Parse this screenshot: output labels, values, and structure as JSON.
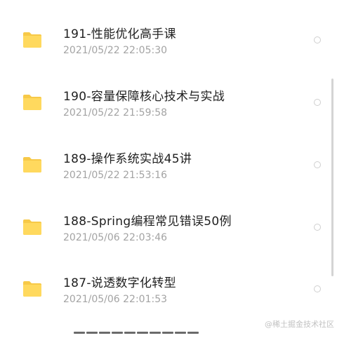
{
  "file_list": {
    "items": [
      {
        "name": "191-性能优化高手课",
        "date": "2021/05/22 22:05:30"
      },
      {
        "name": "190-容量保障核心技术与实战",
        "date": "2021/05/22 21:59:58"
      },
      {
        "name": "189-操作系统实战45讲",
        "date": "2021/05/22 21:53:16"
      },
      {
        "name": "188-Spring编程常见错误50例",
        "date": "2021/05/06 22:03:46"
      },
      {
        "name": "187-说透数字化转型",
        "date": "2021/05/06 22:01:53"
      }
    ]
  },
  "watermark": "@稀土掘金技术社区",
  "colors": {
    "folder": "#FFD95E",
    "folder_tab": "#F7C948",
    "title": "#1f1f1f",
    "date": "#a3a3a3",
    "radio_border": "#cfcfcf",
    "scrollbar": "#d4d4d4"
  }
}
